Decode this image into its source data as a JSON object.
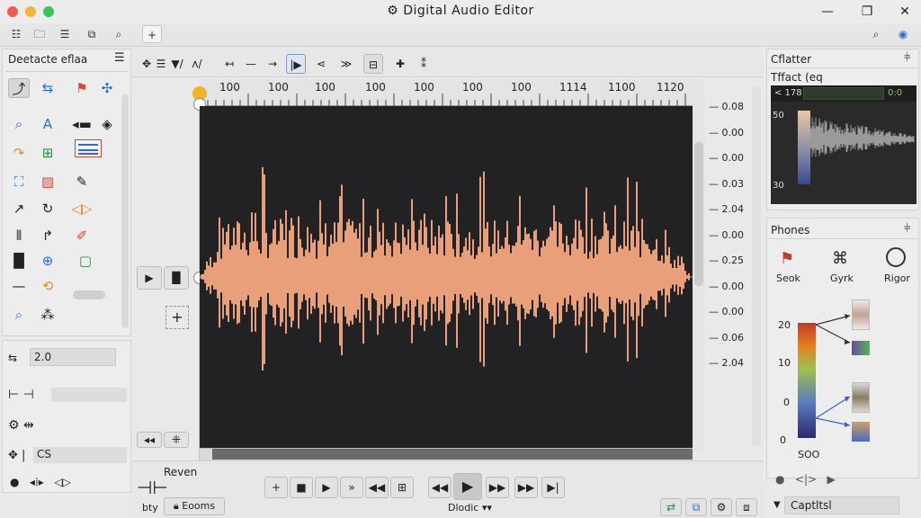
{
  "window": {
    "title": "Digital Audio Editor",
    "title_icon": "gear-icon"
  },
  "colors": {
    "accent": "#e8a97a",
    "waveform": "#e9a07a",
    "background": "#e9e9e9",
    "wave_bg": "#222224",
    "playhead": "#f0b428"
  },
  "left_panel": {
    "title": "Deetacte eflaa",
    "tools": [
      {
        "icon": "cursor-icon"
      },
      {
        "icon": "move-icon"
      },
      {
        "icon": "marker-icon"
      },
      {
        "icon": "crosshair-icon"
      },
      {
        "icon": "zoom-icon"
      },
      {
        "icon": "text-icon"
      },
      {
        "icon": "speaker-icon"
      },
      {
        "icon": "eye-icon"
      },
      {
        "icon": "curve-icon"
      },
      {
        "icon": "frame-icon"
      },
      {
        "icon": "grid-icon"
      },
      {
        "icon": "select-icon"
      },
      {
        "icon": "image-icon"
      },
      {
        "icon": "pen-icon"
      },
      {
        "icon": "arrow-icon"
      },
      {
        "icon": "loop-icon"
      },
      {
        "icon": "split-icon"
      },
      {
        "icon": "bars-icon"
      },
      {
        "icon": "bend-icon"
      },
      {
        "icon": "brush-icon"
      },
      {
        "icon": "equalizer-icon"
      },
      {
        "icon": "target-icon"
      },
      {
        "icon": "box-icon"
      },
      {
        "icon": "line-icon"
      },
      {
        "icon": "rotate-icon"
      },
      {
        "icon": "slider-icon"
      },
      {
        "icon": "lasso-icon"
      },
      {
        "icon": "scatter-icon"
      }
    ],
    "fields": [
      {
        "label": "2.0"
      },
      {
        "label": ""
      },
      {
        "label": ""
      },
      {
        "label": "CS"
      }
    ]
  },
  "toolbar": {
    "items": [
      "select-icon",
      "grid-icon",
      "draw-icon",
      "tools-icon",
      "prev-icon",
      "back-icon",
      "next-icon",
      "play-cursor-icon",
      "loop-icon",
      "sync-icon",
      "frame-icon",
      "cut-icon",
      "more-icon"
    ]
  },
  "ruler": {
    "labels": [
      "100",
      "100",
      "100",
      "100",
      "100",
      "100",
      "100",
      "100",
      "100",
      "100",
      "1114",
      "1100",
      "1120"
    ]
  },
  "db_scale": [
    "0.08",
    "0.00",
    "0.00",
    "0.03",
    "2.04",
    "0.00",
    "0.25",
    "0.00",
    "0.00",
    "0.06",
    "2.04"
  ],
  "transport": {
    "label_top": "Reven",
    "bottom_left_a": "bty",
    "bottom_left_b": "Eooms",
    "mode": "Dlodic",
    "mode_suffix": "▾▾"
  },
  "right_panel": {
    "section1_title": "Cflatter",
    "section1_sub": "Tffact (eq",
    "meter_left": "< 178",
    "meter_right": "0:0",
    "y_top": "50",
    "y_bottom": "30",
    "section2_title": "Phones",
    "buttons": [
      {
        "label": "Seok",
        "icon": "flag-icon"
      },
      {
        "label": "Gyrk",
        "icon": "router-icon"
      },
      {
        "label": "Rigor",
        "icon": "dial-icon"
      }
    ],
    "legend": [
      "20",
      "10",
      "0",
      "0"
    ],
    "legend_bottom": "SOO",
    "footer": "Captltsl"
  }
}
